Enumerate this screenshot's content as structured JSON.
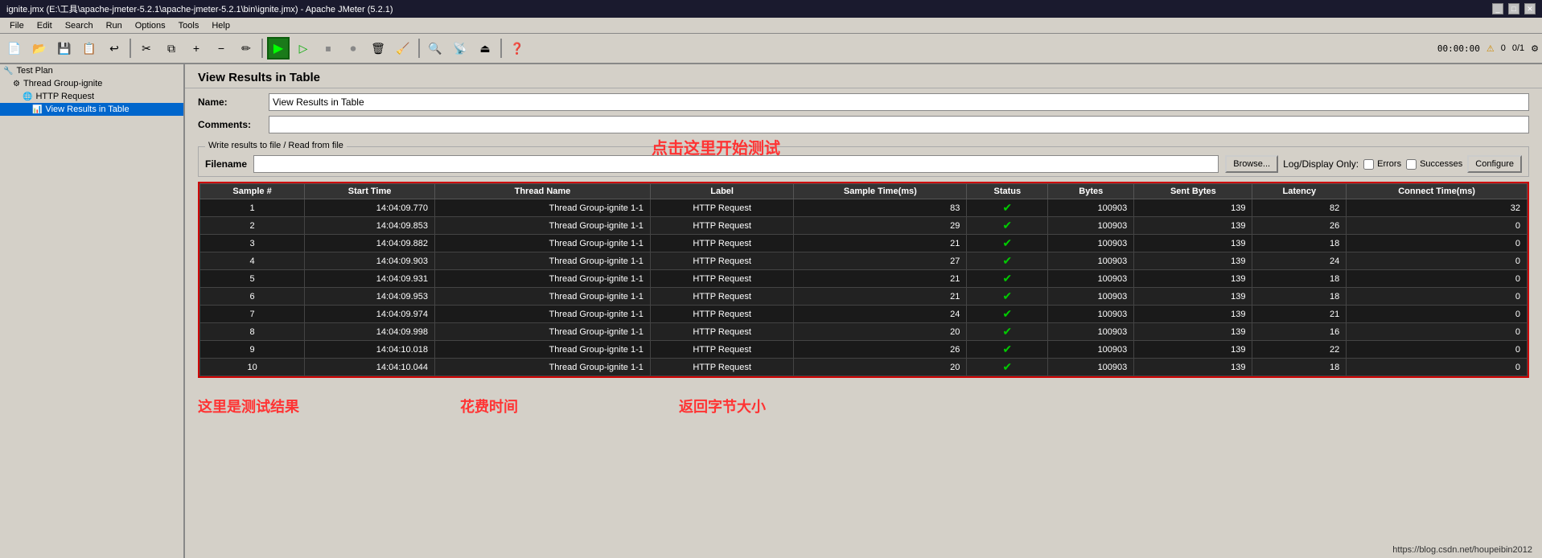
{
  "window": {
    "title": "ignite.jmx (E:\\工具\\apache-jmeter-5.2.1\\apache-jmeter-5.2.1\\bin\\ignite.jmx) - Apache JMeter (5.2.1)",
    "controls": [
      "_",
      "□",
      "✕"
    ]
  },
  "menu": {
    "items": [
      "File",
      "Edit",
      "Search",
      "Run",
      "Options",
      "Tools",
      "Help"
    ]
  },
  "toolbar": {
    "time": "00:00:00",
    "warning_count": "0",
    "ratio": "0/1",
    "play_label": "▶",
    "annotation_click": "点击这里开始测试"
  },
  "sidebar": {
    "items": [
      {
        "label": "Test Plan",
        "icon": "🔧",
        "indent": 0,
        "selected": false
      },
      {
        "label": "Thread Group-ignite",
        "icon": "⚙",
        "indent": 1,
        "selected": false
      },
      {
        "label": "HTTP Request",
        "icon": "🌐",
        "indent": 2,
        "selected": false
      },
      {
        "label": "View Results in Table",
        "icon": "📊",
        "indent": 3,
        "selected": true
      }
    ]
  },
  "panel": {
    "title": "View Results in Table",
    "name_label": "Name:",
    "name_value": "View Results in Table",
    "comments_label": "Comments:",
    "comments_value": "",
    "file_group_legend": "Write results to file / Read from file",
    "filename_label": "Filename",
    "filename_value": "",
    "browse_btn": "Browse...",
    "log_display_label": "Log/Display Only:",
    "errors_label": "Errors",
    "errors_checked": false,
    "successes_label": "Successes",
    "successes_checked": false,
    "configure_btn": "Configure"
  },
  "table": {
    "headers": [
      "Sample #",
      "Start Time",
      "Thread Name",
      "Label",
      "Sample Time(ms)",
      "Status",
      "Bytes",
      "Sent Bytes",
      "Latency",
      "Connect Time(ms)"
    ],
    "rows": [
      {
        "sample": "1",
        "start_time": "14:04:09.770",
        "thread": "Thread Group-ignite 1-1",
        "label": "HTTP Request",
        "sample_time": "83",
        "status": "✓",
        "bytes": "100903",
        "sent_bytes": "139",
        "latency": "82",
        "connect": "32"
      },
      {
        "sample": "2",
        "start_time": "14:04:09.853",
        "thread": "Thread Group-ignite 1-1",
        "label": "HTTP Request",
        "sample_time": "29",
        "status": "✓",
        "bytes": "100903",
        "sent_bytes": "139",
        "latency": "26",
        "connect": "0"
      },
      {
        "sample": "3",
        "start_time": "14:04:09.882",
        "thread": "Thread Group-ignite 1-1",
        "label": "HTTP Request",
        "sample_time": "21",
        "status": "✓",
        "bytes": "100903",
        "sent_bytes": "139",
        "latency": "18",
        "connect": "0"
      },
      {
        "sample": "4",
        "start_time": "14:04:09.903",
        "thread": "Thread Group-ignite 1-1",
        "label": "HTTP Request",
        "sample_time": "27",
        "status": "✓",
        "bytes": "100903",
        "sent_bytes": "139",
        "latency": "24",
        "connect": "0"
      },
      {
        "sample": "5",
        "start_time": "14:04:09.931",
        "thread": "Thread Group-ignite 1-1",
        "label": "HTTP Request",
        "sample_time": "21",
        "status": "✓",
        "bytes": "100903",
        "sent_bytes": "139",
        "latency": "18",
        "connect": "0"
      },
      {
        "sample": "6",
        "start_time": "14:04:09.953",
        "thread": "Thread Group-ignite 1-1",
        "label": "HTTP Request",
        "sample_time": "21",
        "status": "✓",
        "bytes": "100903",
        "sent_bytes": "139",
        "latency": "18",
        "connect": "0"
      },
      {
        "sample": "7",
        "start_time": "14:04:09.974",
        "thread": "Thread Group-ignite 1-1",
        "label": "HTTP Request",
        "sample_time": "24",
        "status": "✓",
        "bytes": "100903",
        "sent_bytes": "139",
        "latency": "21",
        "connect": "0"
      },
      {
        "sample": "8",
        "start_time": "14:04:09.998",
        "thread": "Thread Group-ignite 1-1",
        "label": "HTTP Request",
        "sample_time": "20",
        "status": "✓",
        "bytes": "100903",
        "sent_bytes": "139",
        "latency": "16",
        "connect": "0"
      },
      {
        "sample": "9",
        "start_time": "14:04:10.018",
        "thread": "Thread Group-ignite 1-1",
        "label": "HTTP Request",
        "sample_time": "26",
        "status": "✓",
        "bytes": "100903",
        "sent_bytes": "139",
        "latency": "22",
        "connect": "0"
      },
      {
        "sample": "10",
        "start_time": "14:04:10.044",
        "thread": "Thread Group-ignite 1-1",
        "label": "HTTP Request",
        "sample_time": "20",
        "status": "✓",
        "bytes": "100903",
        "sent_bytes": "139",
        "latency": "18",
        "connect": "0"
      }
    ]
  },
  "annotations": {
    "click_test": "点击这里开始测试",
    "results_here": "这里是测试结果",
    "time_cost": "花费时间",
    "bytes_size": "返回字节大小"
  },
  "footer": {
    "url": "https://blog.csdn.net/houpeibin2012"
  }
}
